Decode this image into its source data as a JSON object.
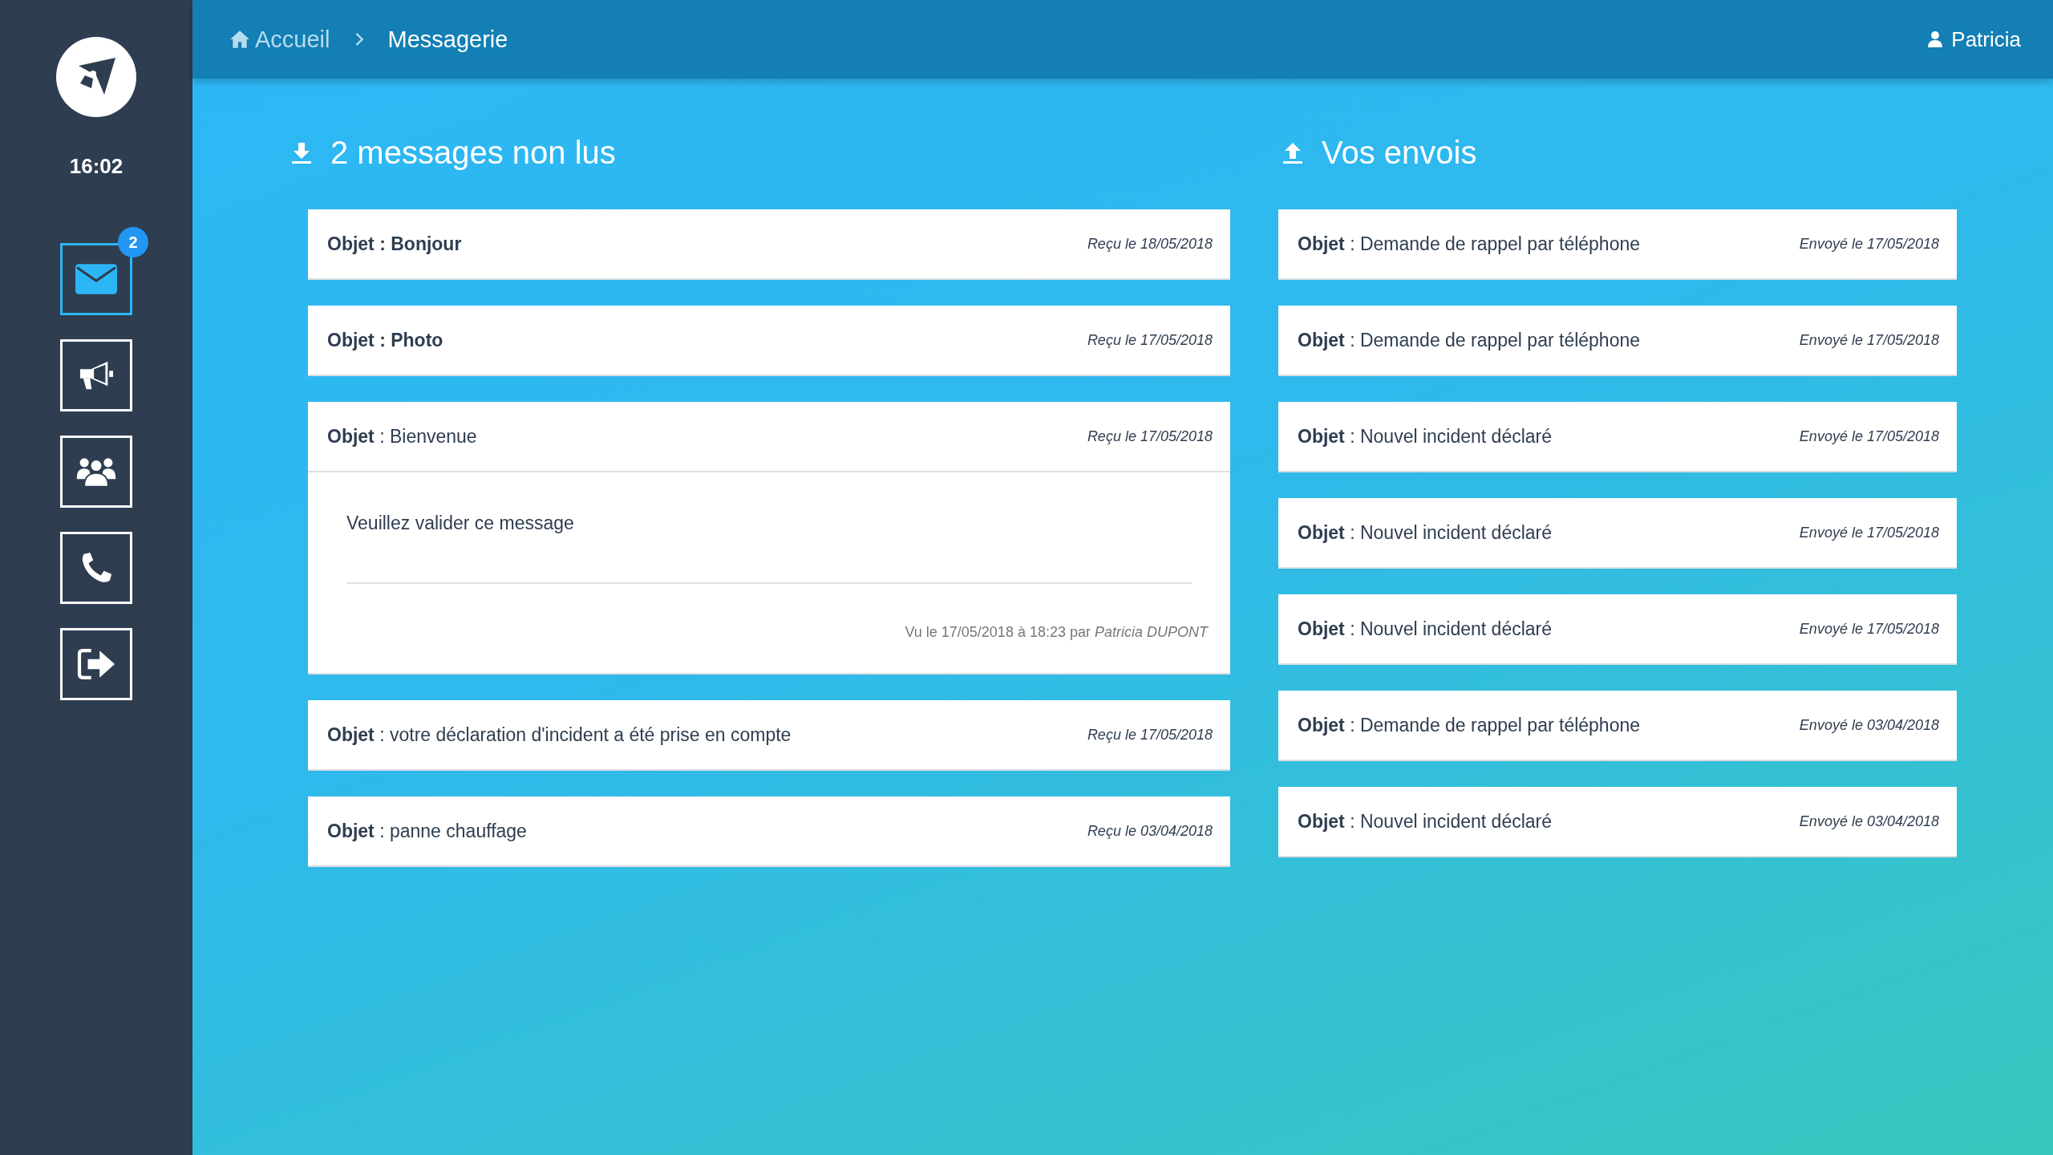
{
  "sidebar": {
    "time": "16:02",
    "nav": [
      {
        "kind": "mail",
        "selected": true,
        "badge": "2"
      },
      {
        "kind": "megaphone",
        "selected": false
      },
      {
        "kind": "users",
        "selected": false
      },
      {
        "kind": "phone",
        "selected": false
      },
      {
        "kind": "logout",
        "selected": false
      }
    ]
  },
  "header": {
    "breadcrumb": [
      {
        "label": "Accueil",
        "kind": "home"
      },
      {
        "label": "Messagerie",
        "kind": "current"
      }
    ],
    "user": "Patricia"
  },
  "inbox": {
    "title": "2 messages non lus",
    "messages": [
      {
        "subject": "Objet : Bonjour",
        "unread": true,
        "date": "Reçu le 18/05/2018",
        "expanded": false
      },
      {
        "subject": "Objet : Photo",
        "unread": true,
        "date": "Reçu le 17/05/2018",
        "expanded": false
      },
      {
        "subject": "**Objet** : Bienvenue",
        "unread": false,
        "date": "Reçu le 17/05/2018",
        "expanded": true,
        "body": "Veuillez valider ce message",
        "seen": "Vu le 17/05/2018 à 18:23 par *Patricia DUPONT*"
      },
      {
        "subject": "**Objet** : votre déclaration d'incident a été prise en compte",
        "unread": false,
        "date": "Reçu le 17/05/2018",
        "expanded": false
      },
      {
        "subject": "**Objet** : panne chauffage",
        "unread": false,
        "date": "Reçu le 03/04/2018",
        "expanded": false
      }
    ]
  },
  "sent": {
    "title": "Vos envois",
    "messages": [
      {
        "subject": "**Objet** : Demande de rappel par téléphone",
        "date": "Envoyé le 17/05/2018"
      },
      {
        "subject": "**Objet** : Demande de rappel par téléphone",
        "date": "Envoyé le 17/05/2018"
      },
      {
        "subject": "**Objet** : Nouvel incident déclaré",
        "date": "Envoyé le 17/05/2018"
      },
      {
        "subject": "**Objet** : Nouvel incident déclaré",
        "date": "Envoyé le 17/05/2018"
      },
      {
        "subject": "**Objet** : Nouvel incident déclaré",
        "date": "Envoyé le 17/05/2018"
      },
      {
        "subject": "**Objet** : Demande de rappel par téléphone",
        "date": "Envoyé le 03/04/2018"
      },
      {
        "subject": "**Objet** : Nouvel incident déclaré",
        "date": "Envoyé le 03/04/2018"
      }
    ]
  }
}
